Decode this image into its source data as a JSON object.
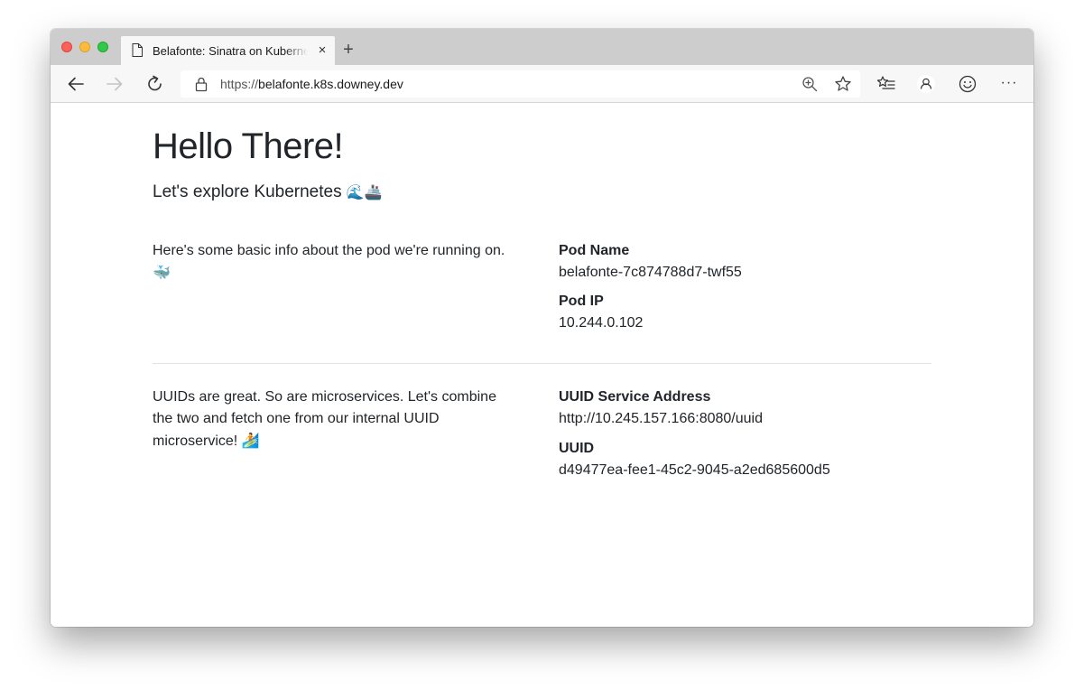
{
  "browser": {
    "tab_title": "Belafonte: Sinatra on Kubernetes",
    "new_tab_symbol": "+",
    "close_symbol": "×",
    "url_scheme": "https://",
    "url_host": "belafonte.k8s.downey.dev",
    "more_symbol": "···"
  },
  "page": {
    "title": "Hello There!",
    "subtitle": "Let's explore Kubernetes",
    "subtitle_emoji": "🌊🚢",
    "pod_section": {
      "description": "Here's some basic info about the pod we're running on.",
      "description_emoji": "🐳",
      "pod_name_label": "Pod Name",
      "pod_name_value": "belafonte-7c874788d7-twf55",
      "pod_ip_label": "Pod IP",
      "pod_ip_value": "10.244.0.102"
    },
    "uuid_section": {
      "description": "UUIDs are great. So are microservices. Let's combine the two and fetch one from our internal UUID microservice!",
      "description_emoji": "🏄",
      "service_address_label": "UUID Service Address",
      "service_address_value": "http://10.245.157.166:8080/uuid",
      "uuid_label": "UUID",
      "uuid_value": "d49477ea-fee1-45c2-9045-a2ed685600d5"
    }
  }
}
